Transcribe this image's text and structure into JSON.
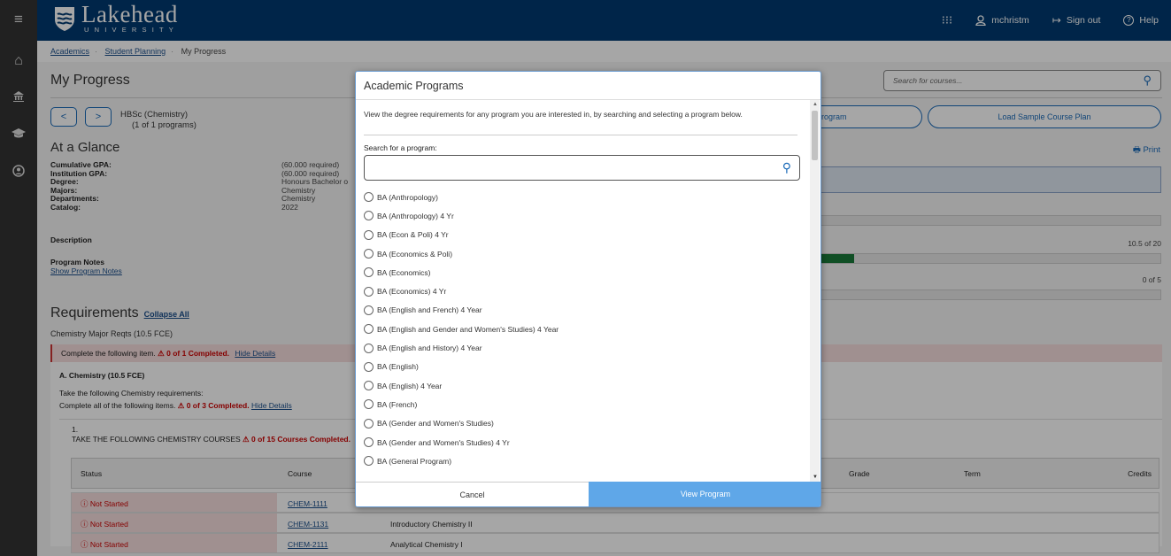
{
  "header": {
    "logo_main": "Lakehead",
    "logo_sub": "UNIVERSITY",
    "apps_icon": "grid-icon",
    "user": "mchristm",
    "signout": "Sign out",
    "help": "Help"
  },
  "sidebar": {
    "icons": [
      "menu-icon",
      "home-icon",
      "bank-icon",
      "graduation-cap-icon",
      "user-circle-icon"
    ]
  },
  "breadcrumb": {
    "items": [
      "Academics",
      "Student Planning",
      "My Progress"
    ]
  },
  "page": {
    "title": "My Progress",
    "search_placeholder": "Search for courses...",
    "program_name": "HBSc (Chemistry)",
    "program_count": "(1 of 1 programs)",
    "view_program_btn": "rogram",
    "load_sample_btn": "Load Sample Course Plan",
    "glance_title": "At a Glance",
    "print": "Print",
    "glance_keys": [
      "Cumulative GPA:",
      "Institution GPA:",
      "Degree:",
      "Majors:",
      "Departments:",
      "Catalog:"
    ],
    "glance_vals": [
      "(60.000 required)",
      "(60.000 required)",
      "Honours Bachelor o",
      "Chemistry",
      "Chemistry",
      "2022"
    ],
    "description_label": "Description",
    "notes_label": "Program Notes",
    "notes_link": "Show Program Notes",
    "progress1_label": "10.5 of 20",
    "progress1_fraction": 0.1,
    "progress2_label": "0 of 5",
    "req_title": "Requirements",
    "collapse_all": "Collapse All",
    "req_sub": "Chemistry Major Reqts (10.5 FCE)",
    "complete_following": "Complete the following item.",
    "complete_status": "0 of 1 Completed.",
    "hide_details": "Hide Details",
    "group_title": "A. Chemistry (10.5 FCE)",
    "group_line1": "Take the following Chemistry requirements:",
    "group_line2": "Complete all of the following items.",
    "group_status": "0 of 3 Completed.",
    "item_num": "1.",
    "item_title": "TAKE THE FOLLOWING CHEMISTRY COURSES",
    "item_status": "0 of 15 Courses Completed.",
    "table_headers": {
      "status": "Status",
      "course": "Course",
      "grade": "Grade",
      "term": "Term",
      "credits": "Credits"
    },
    "rows": [
      {
        "status": "Not Started",
        "course": "CHEM-1111",
        "title": ""
      },
      {
        "status": "Not Started",
        "course": "CHEM-1131",
        "title": "Introductory Chemistry II"
      },
      {
        "status": "Not Started",
        "course": "CHEM-2111",
        "title": "Analytical Chemistry I"
      }
    ]
  },
  "modal": {
    "title": "Academic Programs",
    "description": "View the degree requirements for any program you are interested in, by searching and selecting a program below.",
    "search_label": "Search for a program:",
    "search_value": "",
    "options": [
      "BA (Anthropology)",
      "BA (Anthropology) 4 Yr",
      "BA (Econ & Poli) 4 Yr",
      "BA (Economics & Poli)",
      "BA (Economics)",
      "BA (Economics) 4 Yr",
      "BA (English and French) 4 Year",
      "BA (English and Gender and Women's Studies) 4 Year",
      "BA (English and History) 4 Year",
      "BA (English)",
      "BA (English) 4 Year",
      "BA (French)",
      "BA (Gender and Women's Studies)",
      "BA (Gender and Women's Studies) 4 Yr",
      "BA (General Program)"
    ],
    "cancel": "Cancel",
    "view_program": "View Program"
  }
}
